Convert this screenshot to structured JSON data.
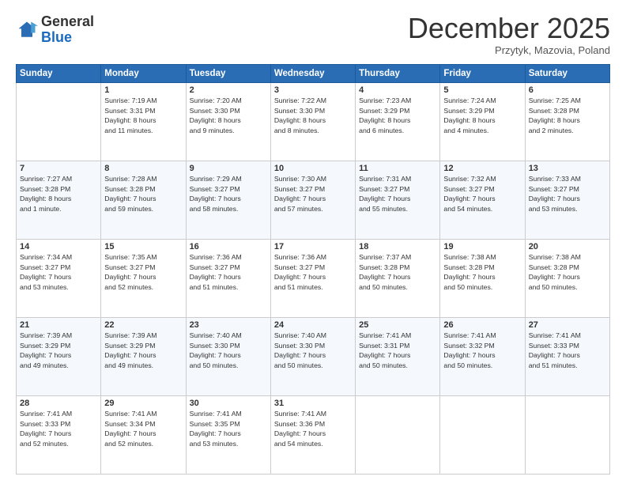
{
  "logo": {
    "general": "General",
    "blue": "Blue"
  },
  "header": {
    "month": "December 2025",
    "location": "Przytyk, Mazovia, Poland"
  },
  "weekdays": [
    "Sunday",
    "Monday",
    "Tuesday",
    "Wednesday",
    "Thursday",
    "Friday",
    "Saturday"
  ],
  "weeks": [
    [
      {
        "day": "",
        "info": ""
      },
      {
        "day": "1",
        "info": "Sunrise: 7:19 AM\nSunset: 3:31 PM\nDaylight: 8 hours\nand 11 minutes."
      },
      {
        "day": "2",
        "info": "Sunrise: 7:20 AM\nSunset: 3:30 PM\nDaylight: 8 hours\nand 9 minutes."
      },
      {
        "day": "3",
        "info": "Sunrise: 7:22 AM\nSunset: 3:30 PM\nDaylight: 8 hours\nand 8 minutes."
      },
      {
        "day": "4",
        "info": "Sunrise: 7:23 AM\nSunset: 3:29 PM\nDaylight: 8 hours\nand 6 minutes."
      },
      {
        "day": "5",
        "info": "Sunrise: 7:24 AM\nSunset: 3:29 PM\nDaylight: 8 hours\nand 4 minutes."
      },
      {
        "day": "6",
        "info": "Sunrise: 7:25 AM\nSunset: 3:28 PM\nDaylight: 8 hours\nand 2 minutes."
      }
    ],
    [
      {
        "day": "7",
        "info": "Sunrise: 7:27 AM\nSunset: 3:28 PM\nDaylight: 8 hours\nand 1 minute."
      },
      {
        "day": "8",
        "info": "Sunrise: 7:28 AM\nSunset: 3:28 PM\nDaylight: 7 hours\nand 59 minutes."
      },
      {
        "day": "9",
        "info": "Sunrise: 7:29 AM\nSunset: 3:27 PM\nDaylight: 7 hours\nand 58 minutes."
      },
      {
        "day": "10",
        "info": "Sunrise: 7:30 AM\nSunset: 3:27 PM\nDaylight: 7 hours\nand 57 minutes."
      },
      {
        "day": "11",
        "info": "Sunrise: 7:31 AM\nSunset: 3:27 PM\nDaylight: 7 hours\nand 55 minutes."
      },
      {
        "day": "12",
        "info": "Sunrise: 7:32 AM\nSunset: 3:27 PM\nDaylight: 7 hours\nand 54 minutes."
      },
      {
        "day": "13",
        "info": "Sunrise: 7:33 AM\nSunset: 3:27 PM\nDaylight: 7 hours\nand 53 minutes."
      }
    ],
    [
      {
        "day": "14",
        "info": "Sunrise: 7:34 AM\nSunset: 3:27 PM\nDaylight: 7 hours\nand 53 minutes."
      },
      {
        "day": "15",
        "info": "Sunrise: 7:35 AM\nSunset: 3:27 PM\nDaylight: 7 hours\nand 52 minutes."
      },
      {
        "day": "16",
        "info": "Sunrise: 7:36 AM\nSunset: 3:27 PM\nDaylight: 7 hours\nand 51 minutes."
      },
      {
        "day": "17",
        "info": "Sunrise: 7:36 AM\nSunset: 3:27 PM\nDaylight: 7 hours\nand 51 minutes."
      },
      {
        "day": "18",
        "info": "Sunrise: 7:37 AM\nSunset: 3:28 PM\nDaylight: 7 hours\nand 50 minutes."
      },
      {
        "day": "19",
        "info": "Sunrise: 7:38 AM\nSunset: 3:28 PM\nDaylight: 7 hours\nand 50 minutes."
      },
      {
        "day": "20",
        "info": "Sunrise: 7:38 AM\nSunset: 3:28 PM\nDaylight: 7 hours\nand 50 minutes."
      }
    ],
    [
      {
        "day": "21",
        "info": "Sunrise: 7:39 AM\nSunset: 3:29 PM\nDaylight: 7 hours\nand 49 minutes."
      },
      {
        "day": "22",
        "info": "Sunrise: 7:39 AM\nSunset: 3:29 PM\nDaylight: 7 hours\nand 49 minutes."
      },
      {
        "day": "23",
        "info": "Sunrise: 7:40 AM\nSunset: 3:30 PM\nDaylight: 7 hours\nand 50 minutes."
      },
      {
        "day": "24",
        "info": "Sunrise: 7:40 AM\nSunset: 3:30 PM\nDaylight: 7 hours\nand 50 minutes."
      },
      {
        "day": "25",
        "info": "Sunrise: 7:41 AM\nSunset: 3:31 PM\nDaylight: 7 hours\nand 50 minutes."
      },
      {
        "day": "26",
        "info": "Sunrise: 7:41 AM\nSunset: 3:32 PM\nDaylight: 7 hours\nand 50 minutes."
      },
      {
        "day": "27",
        "info": "Sunrise: 7:41 AM\nSunset: 3:33 PM\nDaylight: 7 hours\nand 51 minutes."
      }
    ],
    [
      {
        "day": "28",
        "info": "Sunrise: 7:41 AM\nSunset: 3:33 PM\nDaylight: 7 hours\nand 52 minutes."
      },
      {
        "day": "29",
        "info": "Sunrise: 7:41 AM\nSunset: 3:34 PM\nDaylight: 7 hours\nand 52 minutes."
      },
      {
        "day": "30",
        "info": "Sunrise: 7:41 AM\nSunset: 3:35 PM\nDaylight: 7 hours\nand 53 minutes."
      },
      {
        "day": "31",
        "info": "Sunrise: 7:41 AM\nSunset: 3:36 PM\nDaylight: 7 hours\nand 54 minutes."
      },
      {
        "day": "",
        "info": ""
      },
      {
        "day": "",
        "info": ""
      },
      {
        "day": "",
        "info": ""
      }
    ]
  ]
}
